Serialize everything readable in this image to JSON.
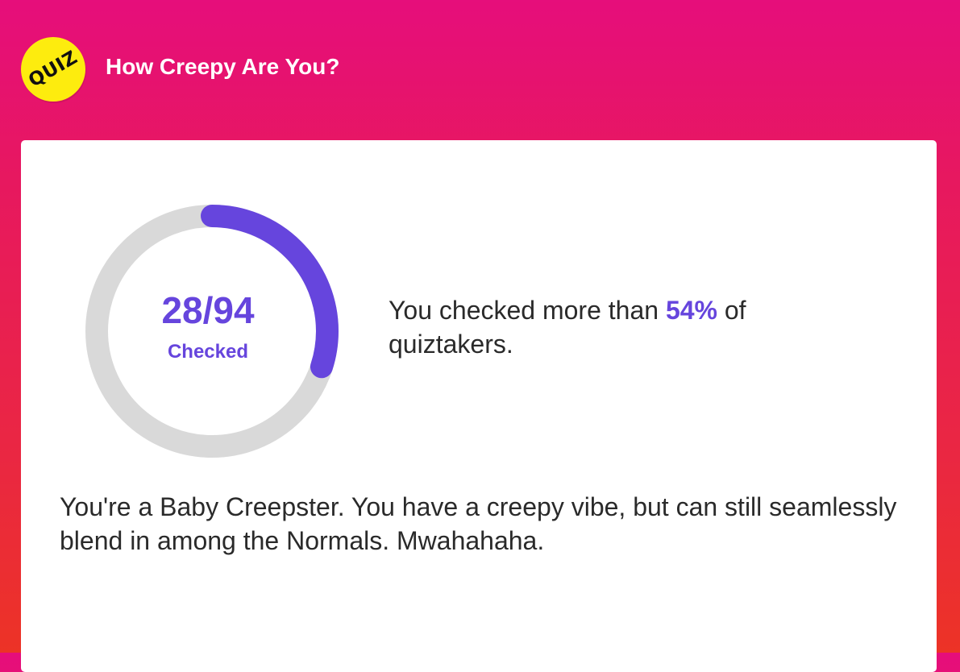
{
  "header": {
    "badge_label": "QUIZ",
    "title": "How Creepy Are You?"
  },
  "result": {
    "count": "28/94",
    "caption": "Checked",
    "checked": 28,
    "total": 94,
    "ring_fill_fraction": 0.3,
    "stat_prefix": "You checked more than",
    "stat_percent": "54%",
    "stat_suffix": "of quiztakers.",
    "description": "You're a Baby Creepster. You have a creepy vibe, but can still seamlessly blend in among the Normals. Mwahahaha."
  },
  "colors": {
    "accent": "#6645dd",
    "ring_track": "#d9d9d9",
    "badge": "#fdec0e",
    "background_top": "#e60e7b",
    "background_bottom": "#ec3326"
  }
}
